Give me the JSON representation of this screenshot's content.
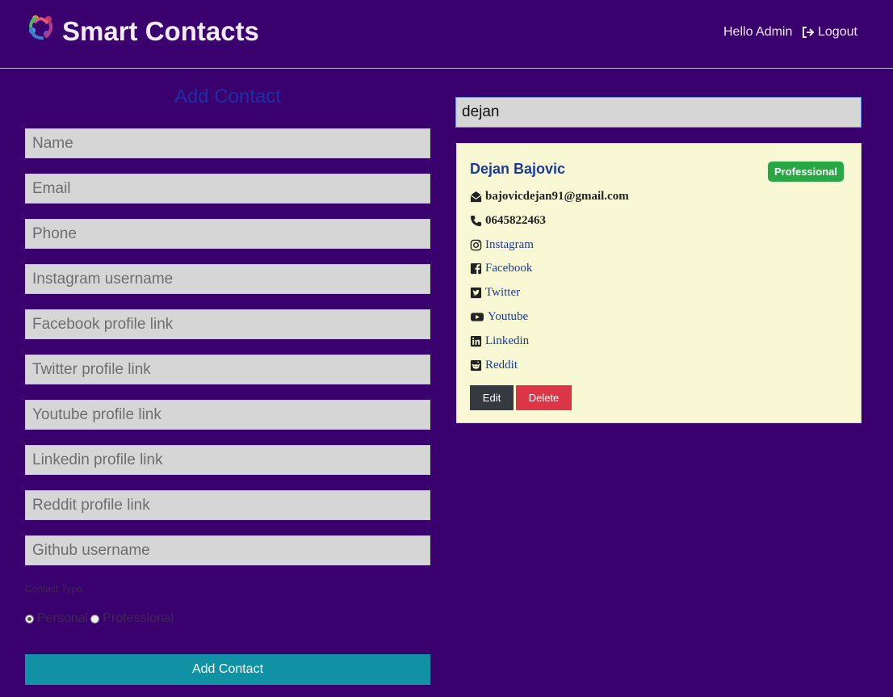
{
  "navbar": {
    "brand": "Smart Contacts",
    "greeting": "Hello Admin",
    "logout_label": "Logout"
  },
  "form": {
    "title": "Add Contact",
    "fields": [
      {
        "placeholder": "Name",
        "value": ""
      },
      {
        "placeholder": "Email",
        "value": ""
      },
      {
        "placeholder": "Phone",
        "value": ""
      },
      {
        "placeholder": "Instagram username",
        "value": ""
      },
      {
        "placeholder": "Facebook profile link",
        "value": ""
      },
      {
        "placeholder": "Twitter profile link",
        "value": ""
      },
      {
        "placeholder": "Youtube profile link",
        "value": ""
      },
      {
        "placeholder": "Linkedin profile link",
        "value": ""
      },
      {
        "placeholder": "Reddit profile link",
        "value": ""
      },
      {
        "placeholder": "Github username",
        "value": ""
      }
    ],
    "contact_type_label": "Contact Type",
    "contact_type_options": [
      "Personal",
      "Professional"
    ],
    "contact_type_selected": "Personal",
    "submit_label": "Add Contact"
  },
  "search": {
    "value": "dejan"
  },
  "contact_card": {
    "name": "Dejan Bajovic",
    "badge": "Professional",
    "email": "bajovicdejan91@gmail.com",
    "phone": "0645822463",
    "links": {
      "instagram": "Instagram",
      "facebook": "Facebook",
      "twitter": "Twitter",
      "youtube": "Youtube",
      "linkedin": "Linkedin",
      "reddit": "Reddit"
    },
    "edit_label": "Edit",
    "delete_label": "Delete"
  },
  "colors": {
    "background": "#3a006e",
    "title": "#1c2fa8",
    "card": "#f8f9d4",
    "badge": "#27a844",
    "submit": "#1192a4",
    "edit": "#343a40",
    "delete": "#dc3545"
  }
}
